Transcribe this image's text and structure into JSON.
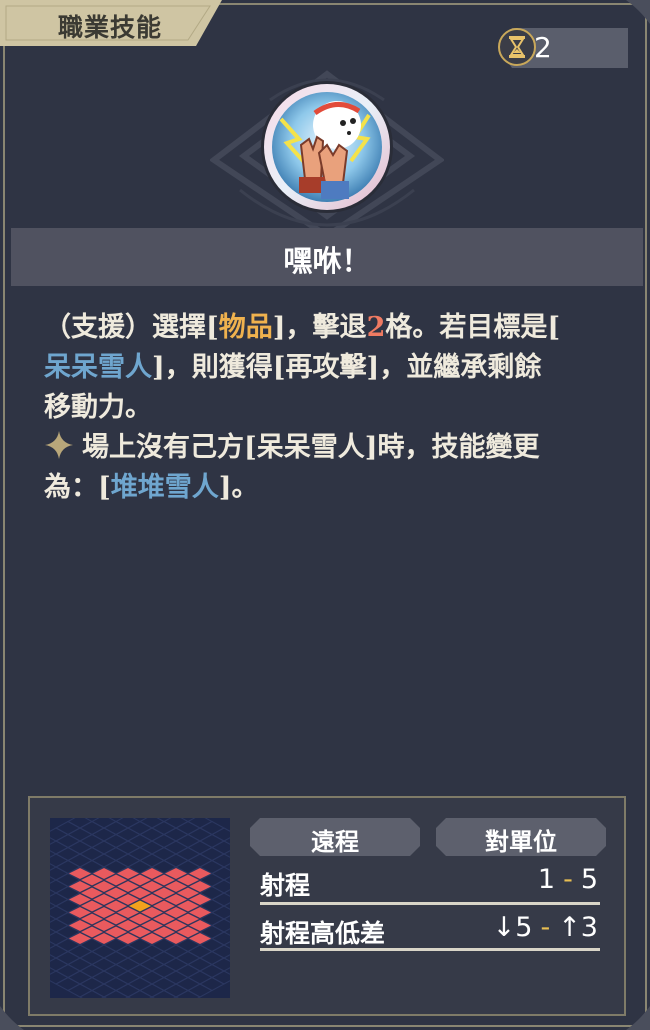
{
  "panel": {
    "title": "職業技能"
  },
  "cost": {
    "value": "2"
  },
  "skill": {
    "name": "嘿咻！"
  },
  "description": {
    "l1_a": "（支援）選擇[",
    "l1_b": "物品",
    "l1_c": "]，擊退",
    "l1_d": "2",
    "l1_e": "格。若目標是[",
    "l2_a": "呆呆雪人",
    "l2_b": "]，則獲得[再攻擊]，並繼承剩餘",
    "l3": "移動力。",
    "l4": "場上沒有己方[呆呆雪人]時，技能變更",
    "l5_a": "為：[",
    "l5_b": "堆堆雪人",
    "l5_c": "]。"
  },
  "range": {
    "tag_type": "遠程",
    "tag_target": "對單位",
    "range_label": "射程",
    "range_min": "1",
    "range_max": "5",
    "height_label": "射程高低差",
    "height_down": "↓5",
    "height_up": "↑3",
    "dash": "-"
  },
  "colors": {
    "background": "#2f3444",
    "gold": "#f0b24e",
    "red": "#ef7a62",
    "blue": "#6fa6cf",
    "tile_range": "#e95a5e",
    "tile_center": "#f3a21c"
  },
  "icons": [
    "hourglass-icon",
    "snowman-skill-icon",
    "four-point-star-icon"
  ]
}
